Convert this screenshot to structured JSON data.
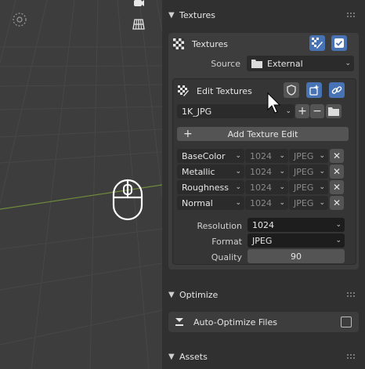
{
  "viewport": {
    "icons": [
      "camera-icon",
      "grid-view-icon",
      "gizmo-icon"
    ],
    "mouse_hint": "mouse-icon"
  },
  "textures_panel": {
    "title": "Textures",
    "textures_label": "Textures",
    "source_label": "Source",
    "source_value": "External",
    "edit_textures_label": "Edit Textures",
    "preset_value": "1K_JPG",
    "add_edit_label": "Add Texture Edit",
    "texture_rows": [
      {
        "name": "BaseColor",
        "size": "1024",
        "format": "JPEG"
      },
      {
        "name": "Metallic",
        "size": "1024",
        "format": "JPEG"
      },
      {
        "name": "Roughness",
        "size": "1024",
        "format": "JPEG"
      },
      {
        "name": "Normal",
        "size": "1024",
        "format": "JPEG"
      }
    ],
    "resolution_label": "Resolution",
    "resolution_value": "1024",
    "format_label": "Format",
    "format_value": "JPEG",
    "quality_label": "Quality",
    "quality_value": "90"
  },
  "optimize_panel": {
    "title": "Optimize",
    "auto_optimize_label": "Auto-Optimize Files",
    "auto_optimize_checked": false
  },
  "assets_panel": {
    "title": "Assets"
  },
  "colors": {
    "accent": "#4772b3",
    "panel_bg": "#3d3d3d",
    "field_bg": "#1d1d1d",
    "grid_green": "#6e8a3a"
  }
}
